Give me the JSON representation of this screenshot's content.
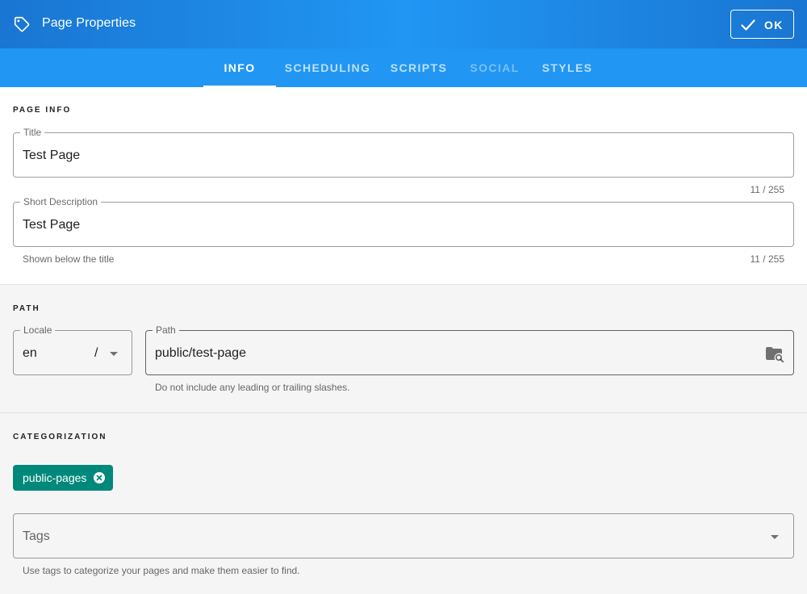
{
  "header": {
    "icon": "tag-outline-icon",
    "title": "Page Properties",
    "ok_label": "OK",
    "ok_icon": "check-icon"
  },
  "tabs": [
    {
      "label": "INFO",
      "state": "active"
    },
    {
      "label": "SCHEDULING",
      "state": "normal"
    },
    {
      "label": "SCRIPTS",
      "state": "normal"
    },
    {
      "label": "SOCIAL",
      "state": "disabled"
    },
    {
      "label": "STYLES",
      "state": "normal"
    }
  ],
  "page_info": {
    "heading": "PAGE INFO",
    "title_label": "Title",
    "title_value": "Test Page",
    "title_counter": "11 / 255",
    "desc_label": "Short Description",
    "desc_value": "Test Page",
    "desc_hint": "Shown below the title",
    "desc_counter": "11 / 255"
  },
  "path": {
    "heading": "PATH",
    "locale_label": "Locale",
    "locale_value": "en",
    "separator": "/",
    "path_label": "Path",
    "path_value": "public/test-page",
    "path_icon": "folder-search-icon",
    "path_hint": "Do not include any leading or trailing slashes."
  },
  "categorization": {
    "heading": "CATEGORIZATION",
    "chips": [
      {
        "label": "public-pages",
        "color": "#00897b"
      }
    ],
    "tags_placeholder": "Tags",
    "tags_hint": "Use tags to categorize your pages and make them easier to find."
  },
  "colors": {
    "primary": "#2196f3",
    "primary_dark": "#1976d2",
    "chip": "#00897b"
  }
}
